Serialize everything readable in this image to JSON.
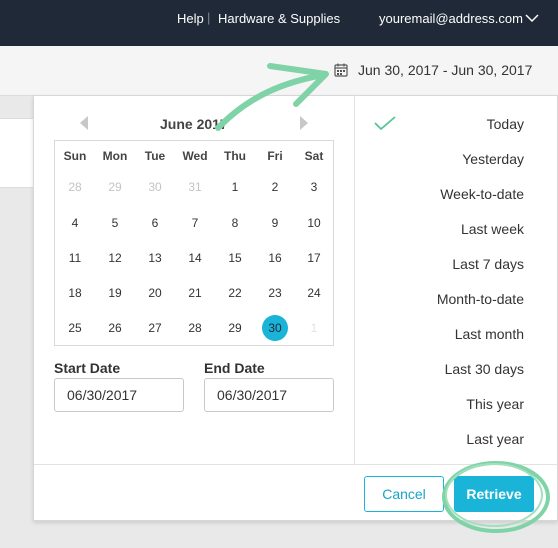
{
  "header": {
    "help": "Help",
    "hardware": "Hardware & Supplies",
    "email": "youremail@address.com"
  },
  "date_range": "Jun 30, 2017 - Jun 30, 2017",
  "calendar": {
    "month_title": "June 2017",
    "weekdays": [
      "Sun",
      "Mon",
      "Tue",
      "Wed",
      "Thu",
      "Fri",
      "Sat"
    ],
    "weeks": [
      [
        "28",
        "29",
        "30",
        "31",
        "1",
        "2",
        "3"
      ],
      [
        "4",
        "5",
        "6",
        "7",
        "8",
        "9",
        "10"
      ],
      [
        "11",
        "12",
        "13",
        "14",
        "15",
        "16",
        "17"
      ],
      [
        "18",
        "19",
        "20",
        "21",
        "22",
        "23",
        "24"
      ],
      [
        "25",
        "26",
        "27",
        "28",
        "29",
        "30",
        "1"
      ]
    ],
    "selected_day": "30"
  },
  "start_date": {
    "label": "Start Date",
    "value": "06/30/2017"
  },
  "end_date": {
    "label": "End Date",
    "value": "06/30/2017"
  },
  "presets": [
    "Today",
    "Yesterday",
    "Week-to-date",
    "Last week",
    "Last 7 days",
    "Month-to-date",
    "Last month",
    "Last 30 days",
    "This year",
    "Last year"
  ],
  "active_preset": "Today",
  "buttons": {
    "cancel": "Cancel",
    "retrieve": "Retrieve"
  },
  "colors": {
    "accent": "#19b4d8",
    "header_bg": "#1f2937",
    "annotation": "#7fd3a6"
  }
}
